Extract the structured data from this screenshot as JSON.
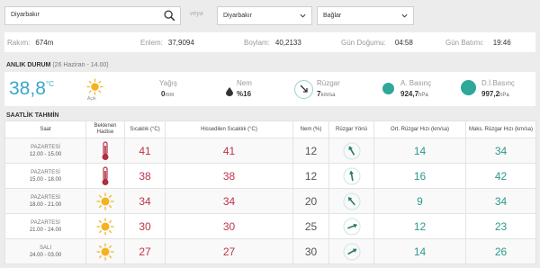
{
  "search": {
    "value": "Diyarbakır"
  },
  "or_label": "veya",
  "province_select": {
    "selected": "Diyarbakır"
  },
  "district_select": {
    "selected": "Bağlar"
  },
  "station_info": [
    {
      "label": "Rakım:",
      "value": "674m"
    },
    {
      "label": "Enlem:",
      "value": "37,9094"
    },
    {
      "label": "Boylam:",
      "value": "40,2133"
    },
    {
      "label": "Gün Doğumu:",
      "value": "04:58"
    },
    {
      "label": "Gün Batımı:",
      "value": "19:46"
    }
  ],
  "current": {
    "title": "ANLIK DURUM",
    "subtitle": "(26 Haziran - 14.00)",
    "temperature": "38,8",
    "temperature_unit": "°C",
    "condition_icon": "sun-icon",
    "condition_caption": "Açık",
    "rain_label": "Yağış",
    "rain_value": "0",
    "rain_unit": "mm",
    "humidity_label": "Nem",
    "humidity_value": "%16",
    "wind_label": "Rüzgar",
    "wind_value": "7",
    "wind_unit": "km/sa",
    "pressure_label": "A. Basınç",
    "pressure_value": "924,7",
    "pressure_unit": "hPa",
    "sea_pressure_label": "D.İ.Basınç",
    "sea_pressure_value": "997,2",
    "sea_pressure_unit": "hPa"
  },
  "hourly": {
    "title": "SAATLİK TAHMİN",
    "columns": {
      "time": "Saat",
      "event": "Beklenen Hadise",
      "temp": "Sıcaklık (°C)",
      "feels": "Hissedilen Sıcaklık (°C)",
      "humidity": "Nem (%)",
      "wind_dir": "Rüzgar Yönü",
      "wind_avg": "Ort. Rüzgar Hızı (km/sa)",
      "wind_max": "Maks. Rüzgar Hızı (km/sa)"
    },
    "rows": [
      {
        "day": "PAZARTESİ",
        "range": "12.00 - 15.00",
        "icon": "thermometer-icon",
        "temp": "41",
        "feels": "41",
        "humidity": "12",
        "wind_avg": "14",
        "wind_max": "34"
      },
      {
        "day": "PAZARTESİ",
        "range": "15.00 - 18.00",
        "icon": "thermometer-icon",
        "temp": "38",
        "feels": "38",
        "humidity": "12",
        "wind_avg": "16",
        "wind_max": "42"
      },
      {
        "day": "PAZARTESİ",
        "range": "18.00 - 21.00",
        "icon": "sun-icon",
        "temp": "34",
        "feels": "34",
        "humidity": "20",
        "wind_avg": "9",
        "wind_max": "34"
      },
      {
        "day": "PAZARTESİ",
        "range": "21.00 - 24.00",
        "icon": "sun-icon",
        "temp": "30",
        "feels": "30",
        "humidity": "25",
        "wind_avg": "12",
        "wind_max": "23"
      },
      {
        "day": "SALI",
        "range": "24.00 - 03.00",
        "icon": "sun-icon",
        "temp": "27",
        "feels": "27",
        "humidity": "30",
        "wind_avg": "14",
        "wind_max": "26"
      }
    ]
  },
  "colors": {
    "accent_blue": "#3aa6c9",
    "hot_red": "#c0334a",
    "teal": "#2b9a8a"
  }
}
